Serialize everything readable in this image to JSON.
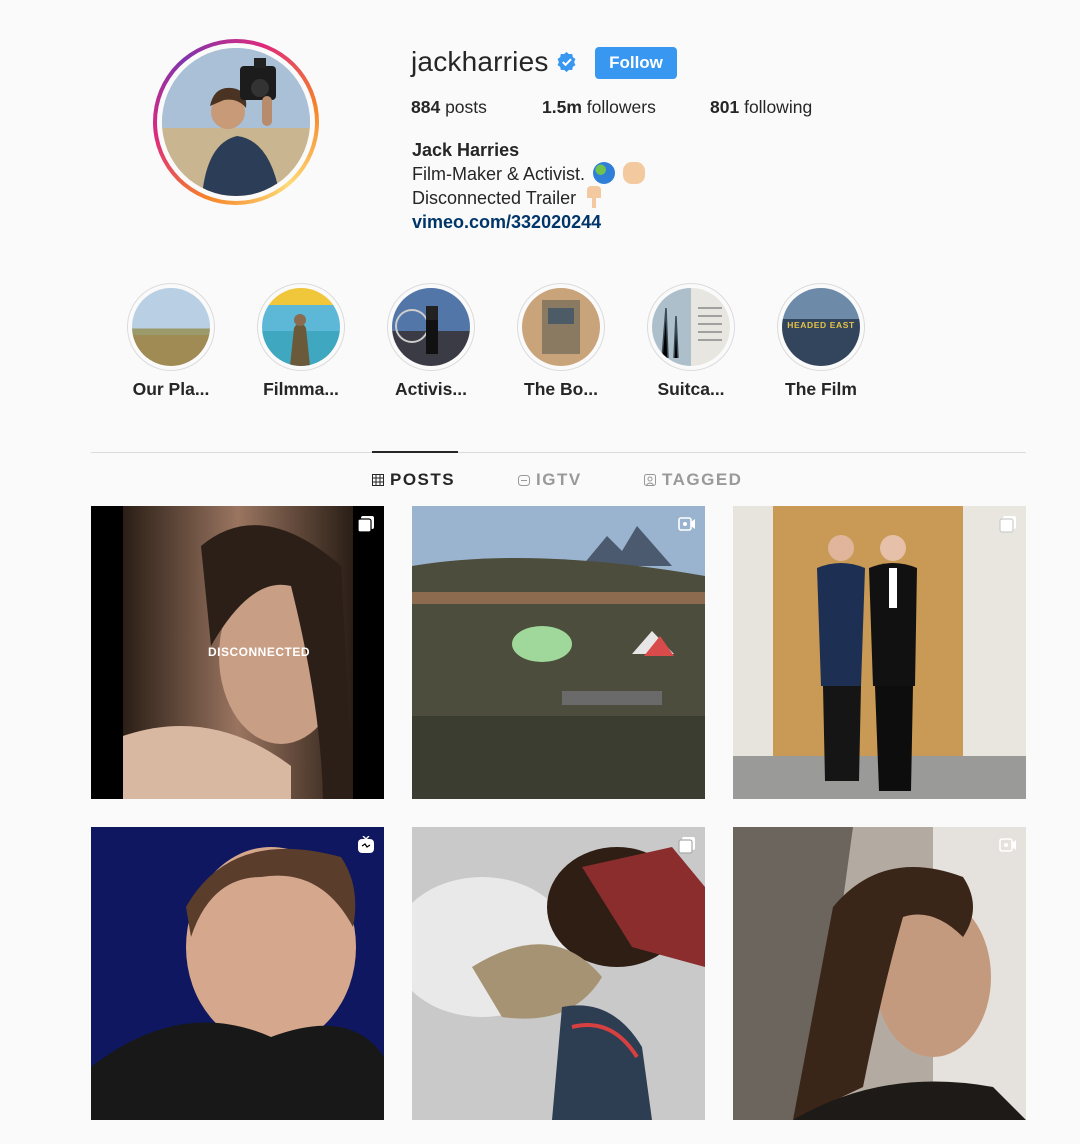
{
  "profile": {
    "username": "jackharries",
    "follow_label": "Follow",
    "stats": {
      "posts_count": "884",
      "posts_label": "posts",
      "followers_count": "1.5m",
      "followers_label": "followers",
      "following_count": "801",
      "following_label": "following"
    },
    "bio": {
      "name": "Jack Harries",
      "line1": "Film-Maker & Activist.",
      "line2": "Disconnected Trailer",
      "link": "vimeo.com/332020244"
    }
  },
  "highlights": [
    {
      "label": "Our Pla..."
    },
    {
      "label": "Filmma..."
    },
    {
      "label": "Activis..."
    },
    {
      "label": "The Bo..."
    },
    {
      "label": "Suitca..."
    },
    {
      "label": "The Film"
    }
  ],
  "highlight_overlay_text": "HEADED EAST",
  "tabs": [
    {
      "label": "POSTS",
      "icon": "grid-icon",
      "active": true
    },
    {
      "label": "IGTV",
      "icon": "igtv-icon",
      "active": false
    },
    {
      "label": "TAGGED",
      "icon": "tagged-icon",
      "active": false
    }
  ],
  "posts": [
    {
      "type": "carousel",
      "icon": "carousel-icon",
      "overlay_text": "DISCONNECTED"
    },
    {
      "type": "video",
      "icon": "video-icon"
    },
    {
      "type": "carousel",
      "icon": "carousel-icon"
    },
    {
      "type": "igtv",
      "icon": "igtv-icon"
    },
    {
      "type": "carousel",
      "icon": "carousel-icon"
    },
    {
      "type": "video",
      "icon": "video-icon"
    }
  ],
  "colors": {
    "accent_blue": "#3897f0",
    "link_blue": "#003569",
    "background": "#fafafa",
    "text": "#262626",
    "muted": "#999999"
  }
}
